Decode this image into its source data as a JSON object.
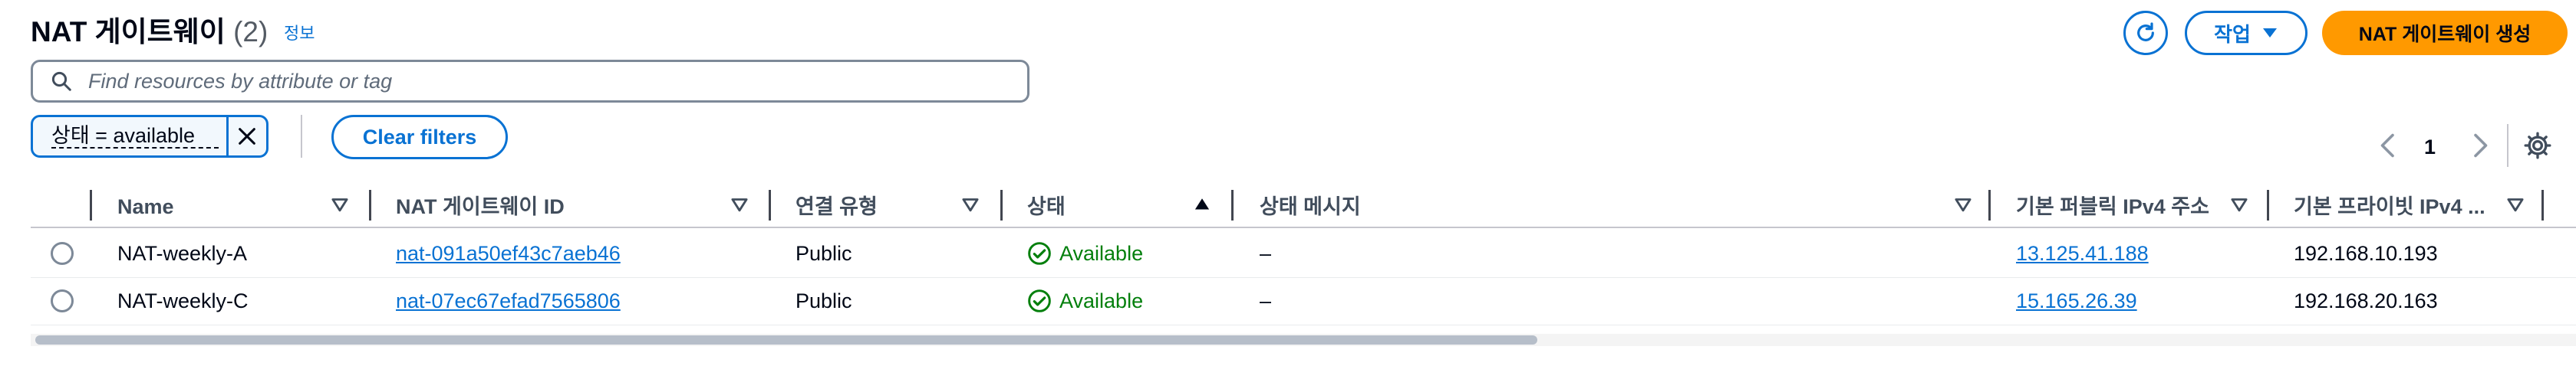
{
  "header": {
    "title": "NAT 게이트웨이",
    "count": "(2)",
    "info_link": "정보",
    "action_label": "작업",
    "create_label": "NAT 게이트웨이 생성"
  },
  "search": {
    "placeholder": "Find resources by attribute or tag"
  },
  "filter": {
    "token_label": "상태 = available",
    "clear_label": "Clear filters"
  },
  "pagination": {
    "current_page": "1"
  },
  "table": {
    "columns": [
      "Name",
      "NAT 게이트웨이 ID",
      "연결 유형",
      "상태",
      "상태 메시지",
      "기본 퍼블릭 IPv4 주소",
      "기본 프라이빗 IPv4 ..."
    ],
    "rows": [
      {
        "name": "NAT-weekly-A",
        "id": "nat-091a50ef43c7aeb46",
        "type": "Public",
        "status": "Available",
        "message": "–",
        "public_ip": "13.125.41.188",
        "private_ip": "192.168.10.193"
      },
      {
        "name": "NAT-weekly-C",
        "id": "nat-07ec67efad7565806",
        "type": "Public",
        "status": "Available",
        "message": "–",
        "public_ip": "15.165.26.39",
        "private_ip": "192.168.20.163"
      }
    ]
  },
  "colors": {
    "accent": "#0972d3",
    "primary_button": "#ff9900",
    "success": "#037f0c"
  },
  "icons": [
    "refresh-icon",
    "caret-down-icon",
    "search-icon",
    "close-icon",
    "chevron-left-icon",
    "chevron-right-icon",
    "settings-icon",
    "sort-caret-icon",
    "status-check-icon"
  ]
}
